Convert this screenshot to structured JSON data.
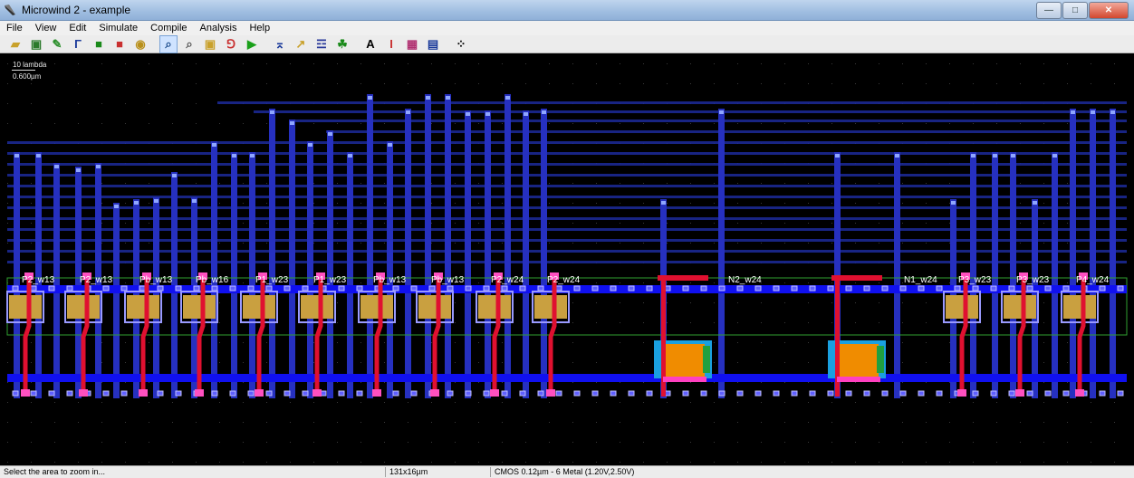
{
  "window": {
    "title": "Microwind 2 - example"
  },
  "menu": [
    "File",
    "View",
    "Edit",
    "Simulate",
    "Compile",
    "Analysis",
    "Help"
  ],
  "toolbar": {
    "icons": [
      {
        "name": "open-file-icon",
        "glyph": "▰",
        "color": "#c9a12b"
      },
      {
        "name": "save-icon",
        "glyph": "▣",
        "color": "#2b7a2b"
      },
      {
        "name": "draw-box-icon",
        "glyph": "✎",
        "color": "#2b8f2b"
      },
      {
        "name": "draw-line-icon",
        "glyph": "Γ",
        "color": "#1a3a9a"
      },
      {
        "name": "cell-icon",
        "glyph": "■",
        "color": "#1a8a1a"
      },
      {
        "name": "stack-icon",
        "glyph": "■",
        "color": "#c93030"
      },
      {
        "name": "device-icon",
        "glyph": "◉",
        "color": "#b9901a"
      },
      {
        "name": "zoom-in-icon",
        "glyph": "⌕",
        "color": "#1c4c8c",
        "active": true
      },
      {
        "name": "zoom-out-icon",
        "glyph": "⌕",
        "color": "#555555"
      },
      {
        "name": "measure-icon",
        "glyph": "▣",
        "color": "#c9a12b"
      },
      {
        "name": "simulate-icon",
        "glyph": "⅁",
        "color": "#c93030"
      },
      {
        "name": "run-icon",
        "glyph": "▶",
        "color": "#1aa01a"
      },
      {
        "name": "connect-icon",
        "glyph": "⌅",
        "color": "#1a3a9a"
      },
      {
        "name": "extract-icon",
        "glyph": "↗",
        "color": "#c9a12b"
      },
      {
        "name": "view-3d-icon",
        "glyph": "☲",
        "color": "#2a3a9a"
      },
      {
        "name": "layer-icon",
        "glyph": "☘",
        "color": "#1a8a1a"
      },
      {
        "name": "text-icon",
        "glyph": "A",
        "color": "#000000"
      },
      {
        "name": "ruler-icon",
        "glyph": "I",
        "color": "#c93030"
      },
      {
        "name": "chart-icon",
        "glyph": "▦",
        "color": "#b03070"
      },
      {
        "name": "palette-icon",
        "glyph": "▤",
        "color": "#1a3a9a"
      },
      {
        "name": "move-arrows-icon",
        "glyph": "⁘",
        "color": "#000000"
      }
    ]
  },
  "scale": {
    "label": "10 lambda",
    "micron": "0.600µm"
  },
  "layout": {
    "cells": [
      {
        "label": "P2_w13"
      },
      {
        "label": "P2_w13"
      },
      {
        "label": "Pb_w13"
      },
      {
        "label": "Pb_w16"
      },
      {
        "label": "P1_w23"
      },
      {
        "label": "P1_w23"
      },
      {
        "label": "Pb_w13"
      },
      {
        "label": "Pb_w13"
      },
      {
        "label": "P2_w24"
      },
      {
        "label": "P2_w24"
      },
      {
        "label": "N2_w24"
      },
      {
        "label": "N1_w24"
      },
      {
        "label": "P3_w23"
      },
      {
        "label": "P3_w23"
      },
      {
        "label": "P4_w24"
      }
    ],
    "colors": {
      "metal1": "#1010f0",
      "metal2": "#2a3ab0",
      "poly": "#e01030",
      "contact": "#c8c8ff",
      "diffusion_p": "#c9a040",
      "diffusion_n": "#f08c00",
      "nwell": "#30a030",
      "pwell_text": "#ffffff"
    }
  },
  "status": {
    "message": "Select the area to zoom in...",
    "size": "131x16µm",
    "tech": "CMOS 0.12µm - 6 Metal (1.20V,2.50V)"
  }
}
